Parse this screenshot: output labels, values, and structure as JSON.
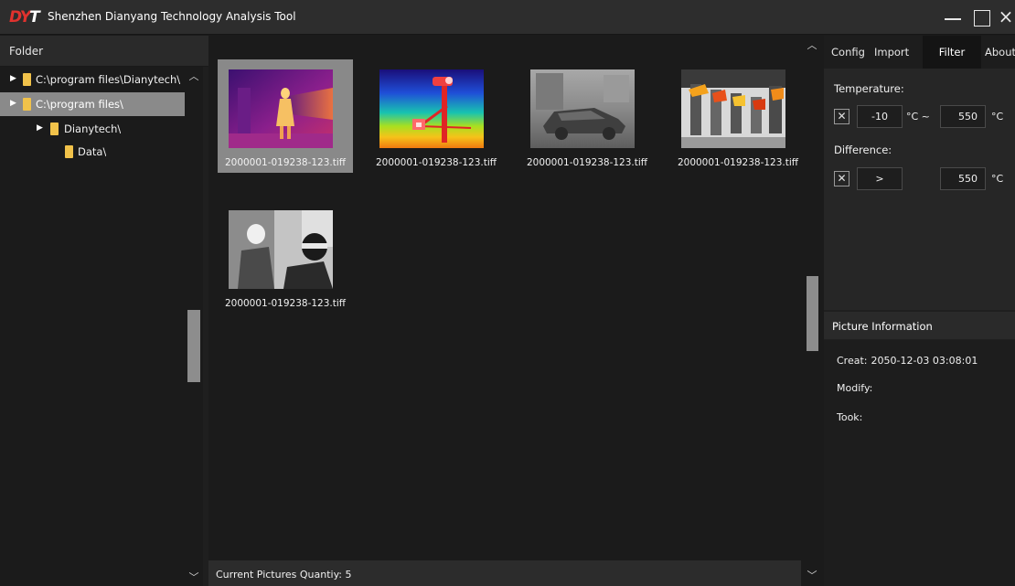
{
  "window": {
    "logo": "DYT",
    "title": "Shenzhen Dianyang Technology Analysis Tool",
    "close_glyph": "×"
  },
  "folder_panel": {
    "header": "Folder",
    "tree": [
      {
        "label": "C:\\program files\\Dianytech\\",
        "level": 0,
        "selected": false
      },
      {
        "label": "C:\\program files\\",
        "level": 0,
        "selected": true
      },
      {
        "label": "Dianytech\\",
        "level": 1,
        "selected": false
      },
      {
        "label": "Data\\",
        "level": 2,
        "selected": false
      }
    ]
  },
  "gallery": {
    "items": [
      {
        "caption": "2000001-019238-123.tiff",
        "selected": true,
        "style": "ironbow"
      },
      {
        "caption": "2000001-019238-123.tiff",
        "selected": false,
        "style": "rainbow"
      },
      {
        "caption": "2000001-019238-123.tiff",
        "selected": false,
        "style": "gray-car"
      },
      {
        "caption": "2000001-019238-123.tiff",
        "selected": false,
        "style": "hot-gray"
      },
      {
        "caption": "2000001-019238-123.tiff",
        "selected": false,
        "style": "gray-person"
      }
    ],
    "status": "Current Pictures Quantiy: 5"
  },
  "right_panel": {
    "tabs": [
      {
        "label": "Config",
        "active": false
      },
      {
        "label": "Import",
        "active": false
      },
      {
        "label": "Filter",
        "active": true
      },
      {
        "label": "About",
        "active": false
      }
    ],
    "filter": {
      "temperature_label": "Temperature:",
      "temp_min": "-10",
      "temp_min_unit": "°C ~",
      "temp_max": "550",
      "temp_max_unit": "°C",
      "difference_label": "Difference:",
      "diff_operator": ">",
      "diff_value": "550",
      "diff_unit": "°C",
      "checkbox_glyph": "✕"
    },
    "info": {
      "header": "Picture Information",
      "creat_label": "Creat:",
      "creat_value": "2050-12-03 03:08:01",
      "modify_label": "Modify:",
      "took_label": "Took:"
    }
  },
  "colors": {
    "logo_red": "#e0322e",
    "folder_yellow": "#f1c24a",
    "selection_gray": "#898989"
  }
}
